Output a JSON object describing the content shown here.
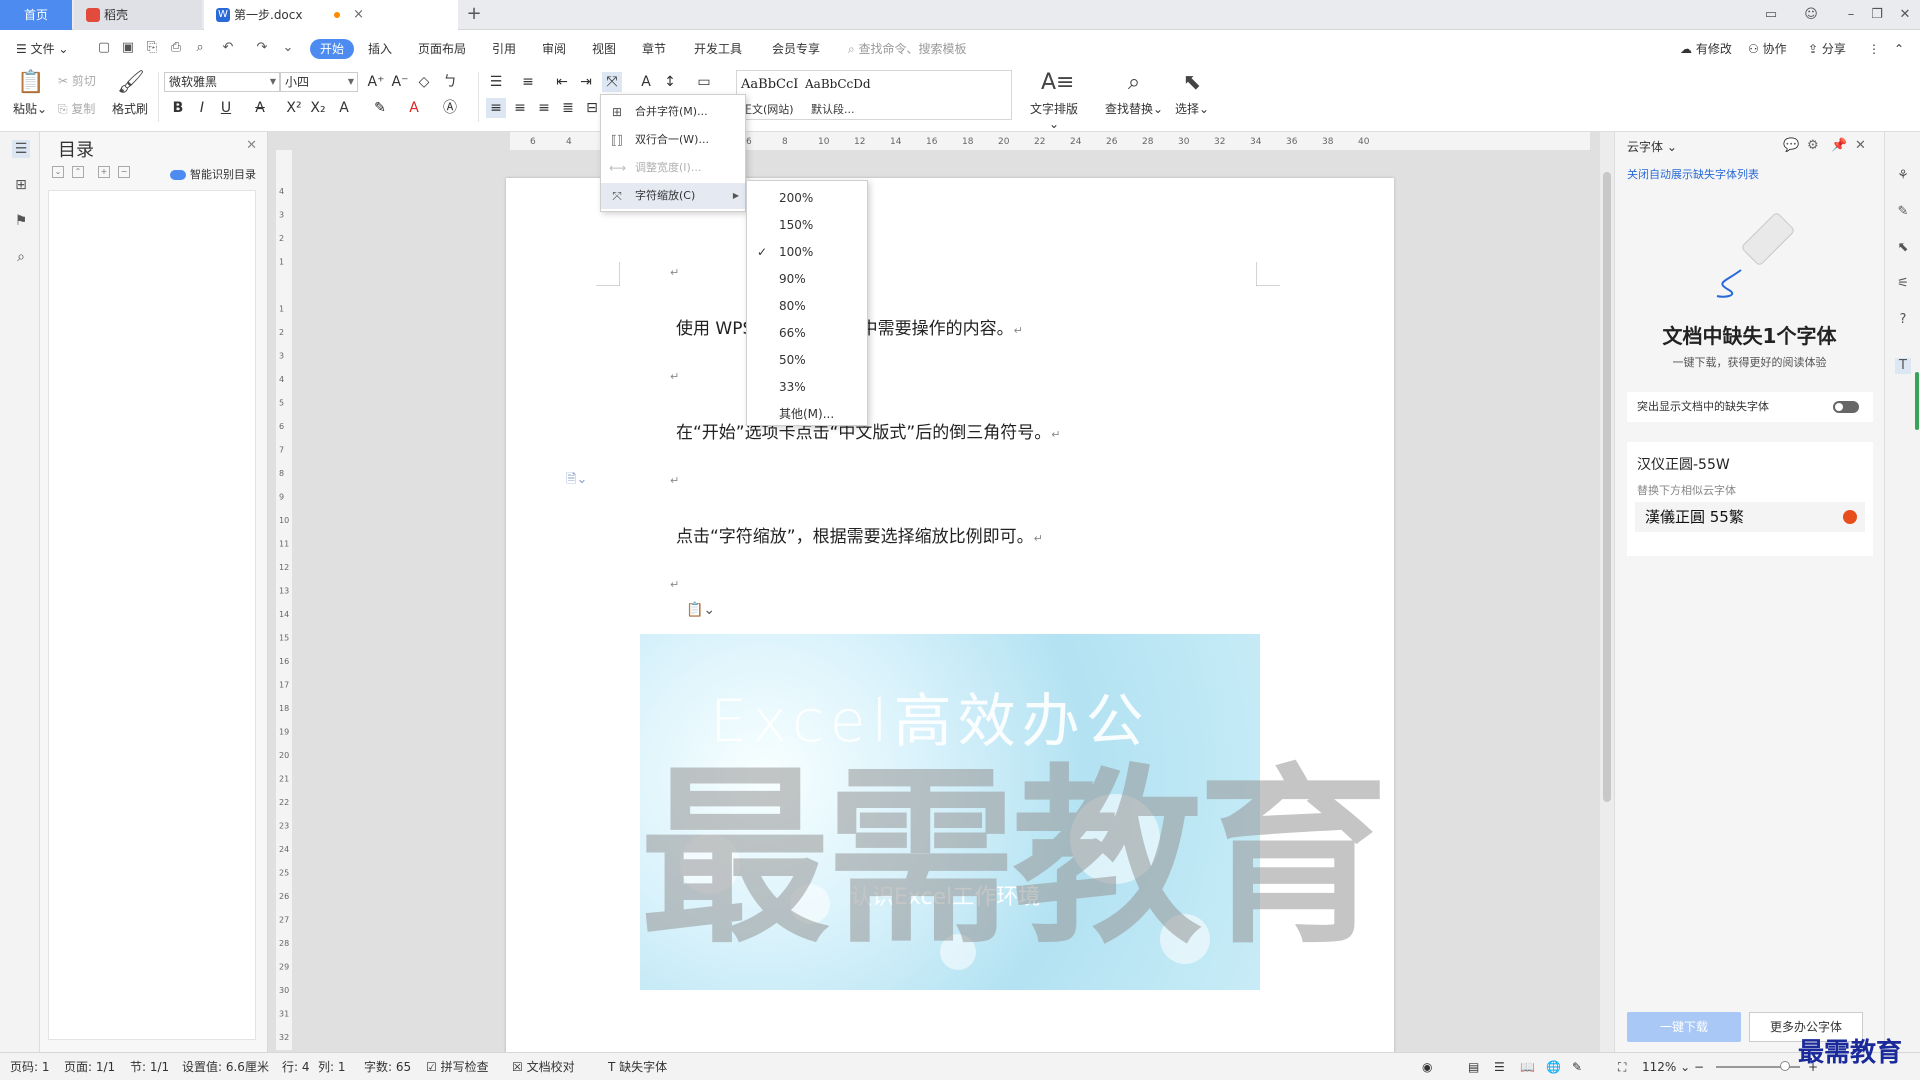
{
  "tabs": {
    "home": "首页",
    "daoke": "稻壳",
    "doc": "第一步.docx",
    "doc_icon": "W",
    "new_tab": "+",
    "close": "×"
  },
  "menubar": {
    "file": "文件",
    "start": "开始",
    "insert": "插入",
    "layout": "页面布局",
    "reference": "引用",
    "review": "审阅",
    "view": "视图",
    "section": "章节",
    "devtools": "开发工具",
    "member": "会员专享",
    "search_placeholder": "查找命令、搜索模板",
    "has_changes": "有修改",
    "collab": "协作",
    "share": "分享"
  },
  "ribbon": {
    "paste": "粘贴",
    "cut": "剪切",
    "copy": "复制",
    "format_painter": "格式刷",
    "font_name": "微软雅黑",
    "font_size": "小四",
    "style1_sample": "AaBbCcI",
    "style1_name": "正文(网站)",
    "style2_sample": "AaBbCcDd",
    "style2_name": "默认段...",
    "text_layout": "文字排版",
    "find_replace": "查找替换",
    "select": "选择"
  },
  "toc": {
    "title": "目录",
    "smart": "智能识别目录"
  },
  "document": {
    "para1": "使用 WPS 打开文档，选中需要操作的内容。",
    "para2": "在“开始”选项卡点击“中文版式”后的倒三角符号。",
    "para3": "点击“字符缩放”，根据需要选择缩放比例即可。",
    "return_mark": "↵",
    "banner_title": "Excel高效办公",
    "banner_sub": "认识Excel工作环境",
    "watermark": "最需教育"
  },
  "menu_main": {
    "items": [
      {
        "label": "合并字符(M)...",
        "icon": "merge-chars-icon",
        "disabled": false
      },
      {
        "label": "双行合一(W)...",
        "icon": "two-lines-icon",
        "disabled": false
      },
      {
        "label": "调整宽度(I)...",
        "icon": "adjust-width-icon",
        "disabled": true
      },
      {
        "label": "字符缩放(C)",
        "icon": "char-scale-icon",
        "disabled": false
      }
    ]
  },
  "menu_scale": {
    "items": [
      "200%",
      "150%",
      "100%",
      "90%",
      "80%",
      "66%",
      "50%",
      "33%",
      "其他(M)..."
    ],
    "checked": "100%"
  },
  "right_panel": {
    "title": "云字体",
    "close_link": "关闭自动展示缺失字体列表",
    "heading": "文档中缺失1个字体",
    "sub": "一键下载，获得更好的阅读体验",
    "toggle_label": "突出显示文档中的缺失字体",
    "font_name": "汉仪正圆-55W",
    "font_hint": "替换下方相似云字体",
    "font_sub": "漢儀正圓 55繁",
    "download": "一键下载",
    "more": "更多办公字体"
  },
  "statusbar": {
    "page_no": "页码: 1",
    "pages": "页面: 1/1",
    "section": "节: 1/1",
    "setting": "设置值: 6.6厘米",
    "row": "行: 4",
    "col": "列: 1",
    "words": "字数: 65",
    "spell": "拼写检查",
    "proof": "文档校对",
    "missing_font": "缺失字体",
    "zoom": "112%"
  },
  "brand_corner": "最需教育",
  "colors": {
    "accent": "#4d8bf0",
    "link": "#2a6ad8"
  }
}
